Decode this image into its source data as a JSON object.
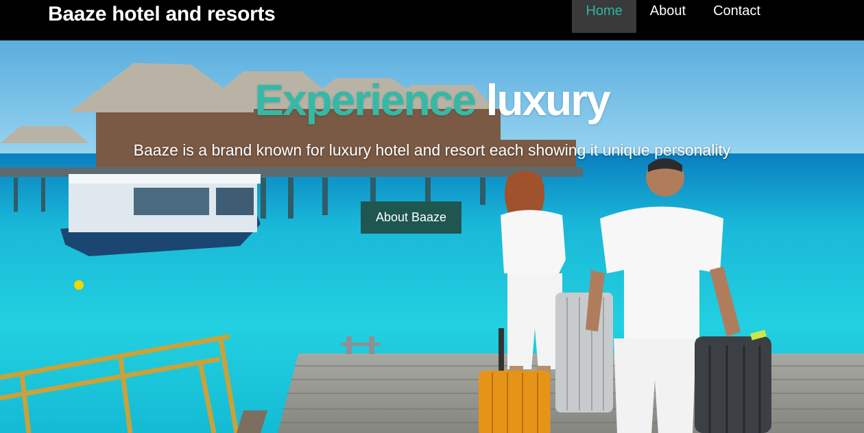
{
  "navbar": {
    "brand": "Baaze hotel and resorts",
    "links": [
      {
        "label": "Home",
        "active": true
      },
      {
        "label": "About",
        "active": false
      },
      {
        "label": "Contact",
        "active": false
      }
    ]
  },
  "hero": {
    "title_accent": "Experience",
    "title_plain": "luxury",
    "subtitle": "Baaze is a brand known for luxury hotel and resort each showing it unique personality",
    "button_label": "About Baaze"
  },
  "colors": {
    "accent": "#35b9a7",
    "navbar_bg": "#000000",
    "active_nav_bg": "#3a3a3a",
    "button_bg": "#1f5650"
  }
}
